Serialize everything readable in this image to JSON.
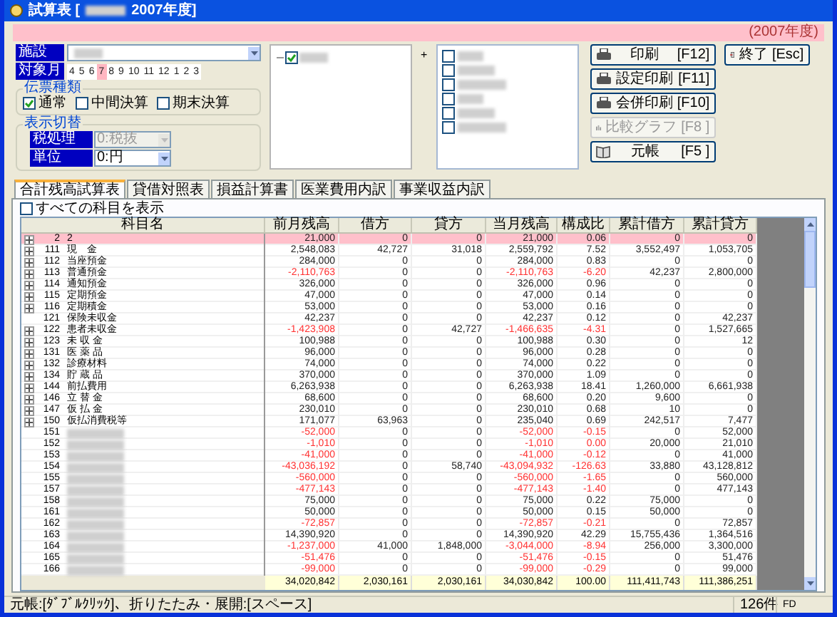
{
  "window": {
    "title": "試算表 [",
    "title_year": "2007年度]"
  },
  "banner": {
    "text": "(2007年度)"
  },
  "facility": {
    "label": "施設"
  },
  "months": {
    "label": "対象月",
    "items": [
      {
        "label": "4",
        "selected": false
      },
      {
        "label": "5",
        "selected": false
      },
      {
        "label": "6",
        "selected": false
      },
      {
        "label": "7",
        "selected": true
      },
      {
        "label": "8",
        "selected": false
      },
      {
        "label": "9",
        "selected": false
      },
      {
        "label": "10",
        "selected": false
      },
      {
        "label": "11",
        "selected": false
      },
      {
        "label": "12",
        "selected": false
      },
      {
        "label": "1",
        "selected": false
      },
      {
        "label": "2",
        "selected": false
      },
      {
        "label": "3",
        "selected": false
      }
    ]
  },
  "slip_types": {
    "title": "伝票種類",
    "options": [
      {
        "label": "通常",
        "checked": true
      },
      {
        "label": "中間決算",
        "checked": false
      },
      {
        "label": "期末決算",
        "checked": false
      }
    ]
  },
  "display": {
    "title": "表示切替",
    "fields": [
      {
        "label": "税処理",
        "value": "0:税抜",
        "disabled": true
      },
      {
        "label": "単位",
        "value": "0:円",
        "disabled": false
      }
    ]
  },
  "tree_left": {
    "items": [
      {
        "checked": true
      }
    ]
  },
  "tree_connector": "+",
  "tree_right": {
    "items": [
      {
        "checked": false
      },
      {
        "checked": false
      },
      {
        "checked": false
      },
      {
        "checked": false
      },
      {
        "checked": false
      },
      {
        "checked": false
      }
    ]
  },
  "buttons": [
    {
      "label": "印刷",
      "key": "[F12]",
      "kind": "printer",
      "disabled": false
    },
    {
      "label": "設定印刷",
      "key": "[F11]",
      "kind": "printer",
      "disabled": false
    },
    {
      "label": "会併印刷",
      "key": "[F10]",
      "kind": "printer",
      "disabled": false
    },
    {
      "label": "比較グラフ",
      "key": "[F8 ]",
      "kind": "chart",
      "disabled": true
    },
    {
      "label": "元帳",
      "key": "[F5 ]",
      "kind": "book",
      "disabled": false
    }
  ],
  "exit_button": {
    "label": "終了",
    "key": "[Esc]"
  },
  "tabs": [
    {
      "label": "合計残高試算表",
      "selected": true
    },
    {
      "label": "貸借対照表",
      "selected": false
    },
    {
      "label": "損益計算書",
      "selected": false
    },
    {
      "label": "医業費用内訳",
      "selected": false
    },
    {
      "label": "事業収益内訳",
      "selected": false
    }
  ],
  "show_all": {
    "label": "すべての科目を表示",
    "checked": false
  },
  "table": {
    "columns": [
      "科目名",
      "前月残高",
      "借方",
      "貸方",
      "当月残高",
      "構成比",
      "累計借方",
      "累計貸方"
    ],
    "rows": [
      {
        "code": "2",
        "name": "2",
        "expandable": true,
        "selected": true,
        "negative": false,
        "values": [
          "21,000",
          "0",
          "0",
          "21,000",
          "0.06",
          "0",
          "0"
        ]
      },
      {
        "code": "111",
        "name": "現　金",
        "expandable": true,
        "selected": false,
        "negative": false,
        "values": [
          "2,548,083",
          "42,727",
          "31,018",
          "2,559,792",
          "7.52",
          "3,552,497",
          "1,053,705"
        ]
      },
      {
        "code": "112",
        "name": "当座預金",
        "expandable": true,
        "selected": false,
        "negative": false,
        "values": [
          "284,000",
          "0",
          "0",
          "284,000",
          "0.83",
          "0",
          "0"
        ]
      },
      {
        "code": "113",
        "name": "普通預金",
        "expandable": true,
        "selected": false,
        "negative": true,
        "values": [
          "-2,110,763",
          "0",
          "0",
          "-2,110,763",
          "-6.20",
          "42,237",
          "2,800,000"
        ]
      },
      {
        "code": "114",
        "name": "通知預金",
        "expandable": true,
        "selected": false,
        "negative": false,
        "values": [
          "326,000",
          "0",
          "0",
          "326,000",
          "0.96",
          "0",
          "0"
        ]
      },
      {
        "code": "115",
        "name": "定期預金",
        "expandable": true,
        "selected": false,
        "negative": false,
        "values": [
          "47,000",
          "0",
          "0",
          "47,000",
          "0.14",
          "0",
          "0"
        ]
      },
      {
        "code": "116",
        "name": "定期積金",
        "expandable": true,
        "selected": false,
        "negative": false,
        "values": [
          "53,000",
          "0",
          "0",
          "53,000",
          "0.16",
          "0",
          "0"
        ]
      },
      {
        "code": "121",
        "name": "保険未収金",
        "expandable": false,
        "selected": false,
        "negative": false,
        "values": [
          "42,237",
          "0",
          "0",
          "42,237",
          "0.12",
          "0",
          "42,237"
        ]
      },
      {
        "code": "122",
        "name": "患者未収金",
        "expandable": true,
        "selected": false,
        "negative": true,
        "values": [
          "-1,423,908",
          "0",
          "42,727",
          "-1,466,635",
          "-4.31",
          "0",
          "1,527,665"
        ]
      },
      {
        "code": "123",
        "name": "未 収 金",
        "expandable": true,
        "selected": false,
        "negative": false,
        "values": [
          "100,988",
          "0",
          "0",
          "100,988",
          "0.30",
          "0",
          "12"
        ]
      },
      {
        "code": "131",
        "name": "医 薬 品",
        "expandable": true,
        "selected": false,
        "negative": false,
        "values": [
          "96,000",
          "0",
          "0",
          "96,000",
          "0.28",
          "0",
          "0"
        ]
      },
      {
        "code": "132",
        "name": "診療材料",
        "expandable": true,
        "selected": false,
        "negative": false,
        "values": [
          "74,000",
          "0",
          "0",
          "74,000",
          "0.22",
          "0",
          "0"
        ]
      },
      {
        "code": "134",
        "name": "貯 蔵 品",
        "expandable": true,
        "selected": false,
        "negative": false,
        "values": [
          "370,000",
          "0",
          "0",
          "370,000",
          "1.09",
          "0",
          "0"
        ]
      },
      {
        "code": "144",
        "name": "前払費用",
        "expandable": true,
        "selected": false,
        "negative": false,
        "values": [
          "6,263,938",
          "0",
          "0",
          "6,263,938",
          "18.41",
          "1,260,000",
          "6,661,938"
        ]
      },
      {
        "code": "146",
        "name": "立 替 金",
        "expandable": true,
        "selected": false,
        "negative": false,
        "values": [
          "68,600",
          "0",
          "0",
          "68,600",
          "0.20",
          "9,600",
          "0"
        ]
      },
      {
        "code": "147",
        "name": "仮 払 金",
        "expandable": true,
        "selected": false,
        "negative": false,
        "values": [
          "230,010",
          "0",
          "0",
          "230,010",
          "0.68",
          "10",
          "0"
        ]
      },
      {
        "code": "150",
        "name": "仮払消費税等",
        "expandable": true,
        "selected": false,
        "negative": false,
        "values": [
          "171,077",
          "63,963",
          "0",
          "235,040",
          "0.69",
          "242,517",
          "7,477"
        ]
      },
      {
        "code": "151",
        "expandable": false,
        "selected": false,
        "negative": true,
        "values": [
          "-52,000",
          "0",
          "0",
          "-52,000",
          "-0.15",
          "0",
          "52,000"
        ]
      },
      {
        "code": "152",
        "expandable": false,
        "selected": false,
        "negative": true,
        "values": [
          "-1,010",
          "0",
          "0",
          "-1,010",
          "0.00",
          "20,000",
          "21,010"
        ]
      },
      {
        "code": "153",
        "expandable": false,
        "selected": false,
        "negative": true,
        "values": [
          "-41,000",
          "0",
          "0",
          "-41,000",
          "-0.12",
          "0",
          "41,000"
        ]
      },
      {
        "code": "154",
        "expandable": false,
        "selected": false,
        "negative": true,
        "values": [
          "-43,036,192",
          "0",
          "58,740",
          "-43,094,932",
          "-126.63",
          "33,880",
          "43,128,812"
        ]
      },
      {
        "code": "155",
        "expandable": false,
        "selected": false,
        "negative": true,
        "values": [
          "-560,000",
          "0",
          "0",
          "-560,000",
          "-1.65",
          "0",
          "560,000"
        ]
      },
      {
        "code": "157",
        "expandable": false,
        "selected": false,
        "negative": true,
        "values": [
          "-477,143",
          "0",
          "0",
          "-477,143",
          "-1.40",
          "0",
          "477,143"
        ]
      },
      {
        "code": "158",
        "expandable": false,
        "selected": false,
        "negative": false,
        "values": [
          "75,000",
          "0",
          "0",
          "75,000",
          "0.22",
          "75,000",
          "0"
        ]
      },
      {
        "code": "161",
        "expandable": false,
        "selected": false,
        "negative": false,
        "values": [
          "50,000",
          "0",
          "0",
          "50,000",
          "0.15",
          "50,000",
          "0"
        ]
      },
      {
        "code": "162",
        "expandable": false,
        "selected": false,
        "negative": true,
        "values": [
          "-72,857",
          "0",
          "0",
          "-72,857",
          "-0.21",
          "0",
          "72,857"
        ]
      },
      {
        "code": "163",
        "expandable": false,
        "selected": false,
        "negative": false,
        "values": [
          "14,390,920",
          "0",
          "0",
          "14,390,920",
          "42.29",
          "15,755,436",
          "1,364,516"
        ]
      },
      {
        "code": "164",
        "expandable": false,
        "selected": false,
        "negative": true,
        "values": [
          "-1,237,000",
          "41,000",
          "1,848,000",
          "-3,044,000",
          "-8.94",
          "256,000",
          "3,300,000"
        ]
      },
      {
        "code": "165",
        "expandable": false,
        "selected": false,
        "negative": true,
        "values": [
          "-51,476",
          "0",
          "0",
          "-51,476",
          "-0.15",
          "0",
          "51,476"
        ]
      },
      {
        "code": "166",
        "expandable": false,
        "selected": false,
        "negative": true,
        "values": [
          "-99,000",
          "0",
          "0",
          "-99,000",
          "-0.29",
          "0",
          "99,000"
        ]
      }
    ],
    "totals": [
      "34,020,842",
      "2,030,161",
      "2,030,161",
      "34,030,842",
      "100.00",
      "111,411,743",
      "111,386,251"
    ]
  },
  "status_bar": {
    "hint": "元帳:[ﾀﾞﾌﾞﾙｸﾘｯｸ]、折りたたみ・展開:[スペース]",
    "count": "126件",
    "mode": "FD"
  }
}
